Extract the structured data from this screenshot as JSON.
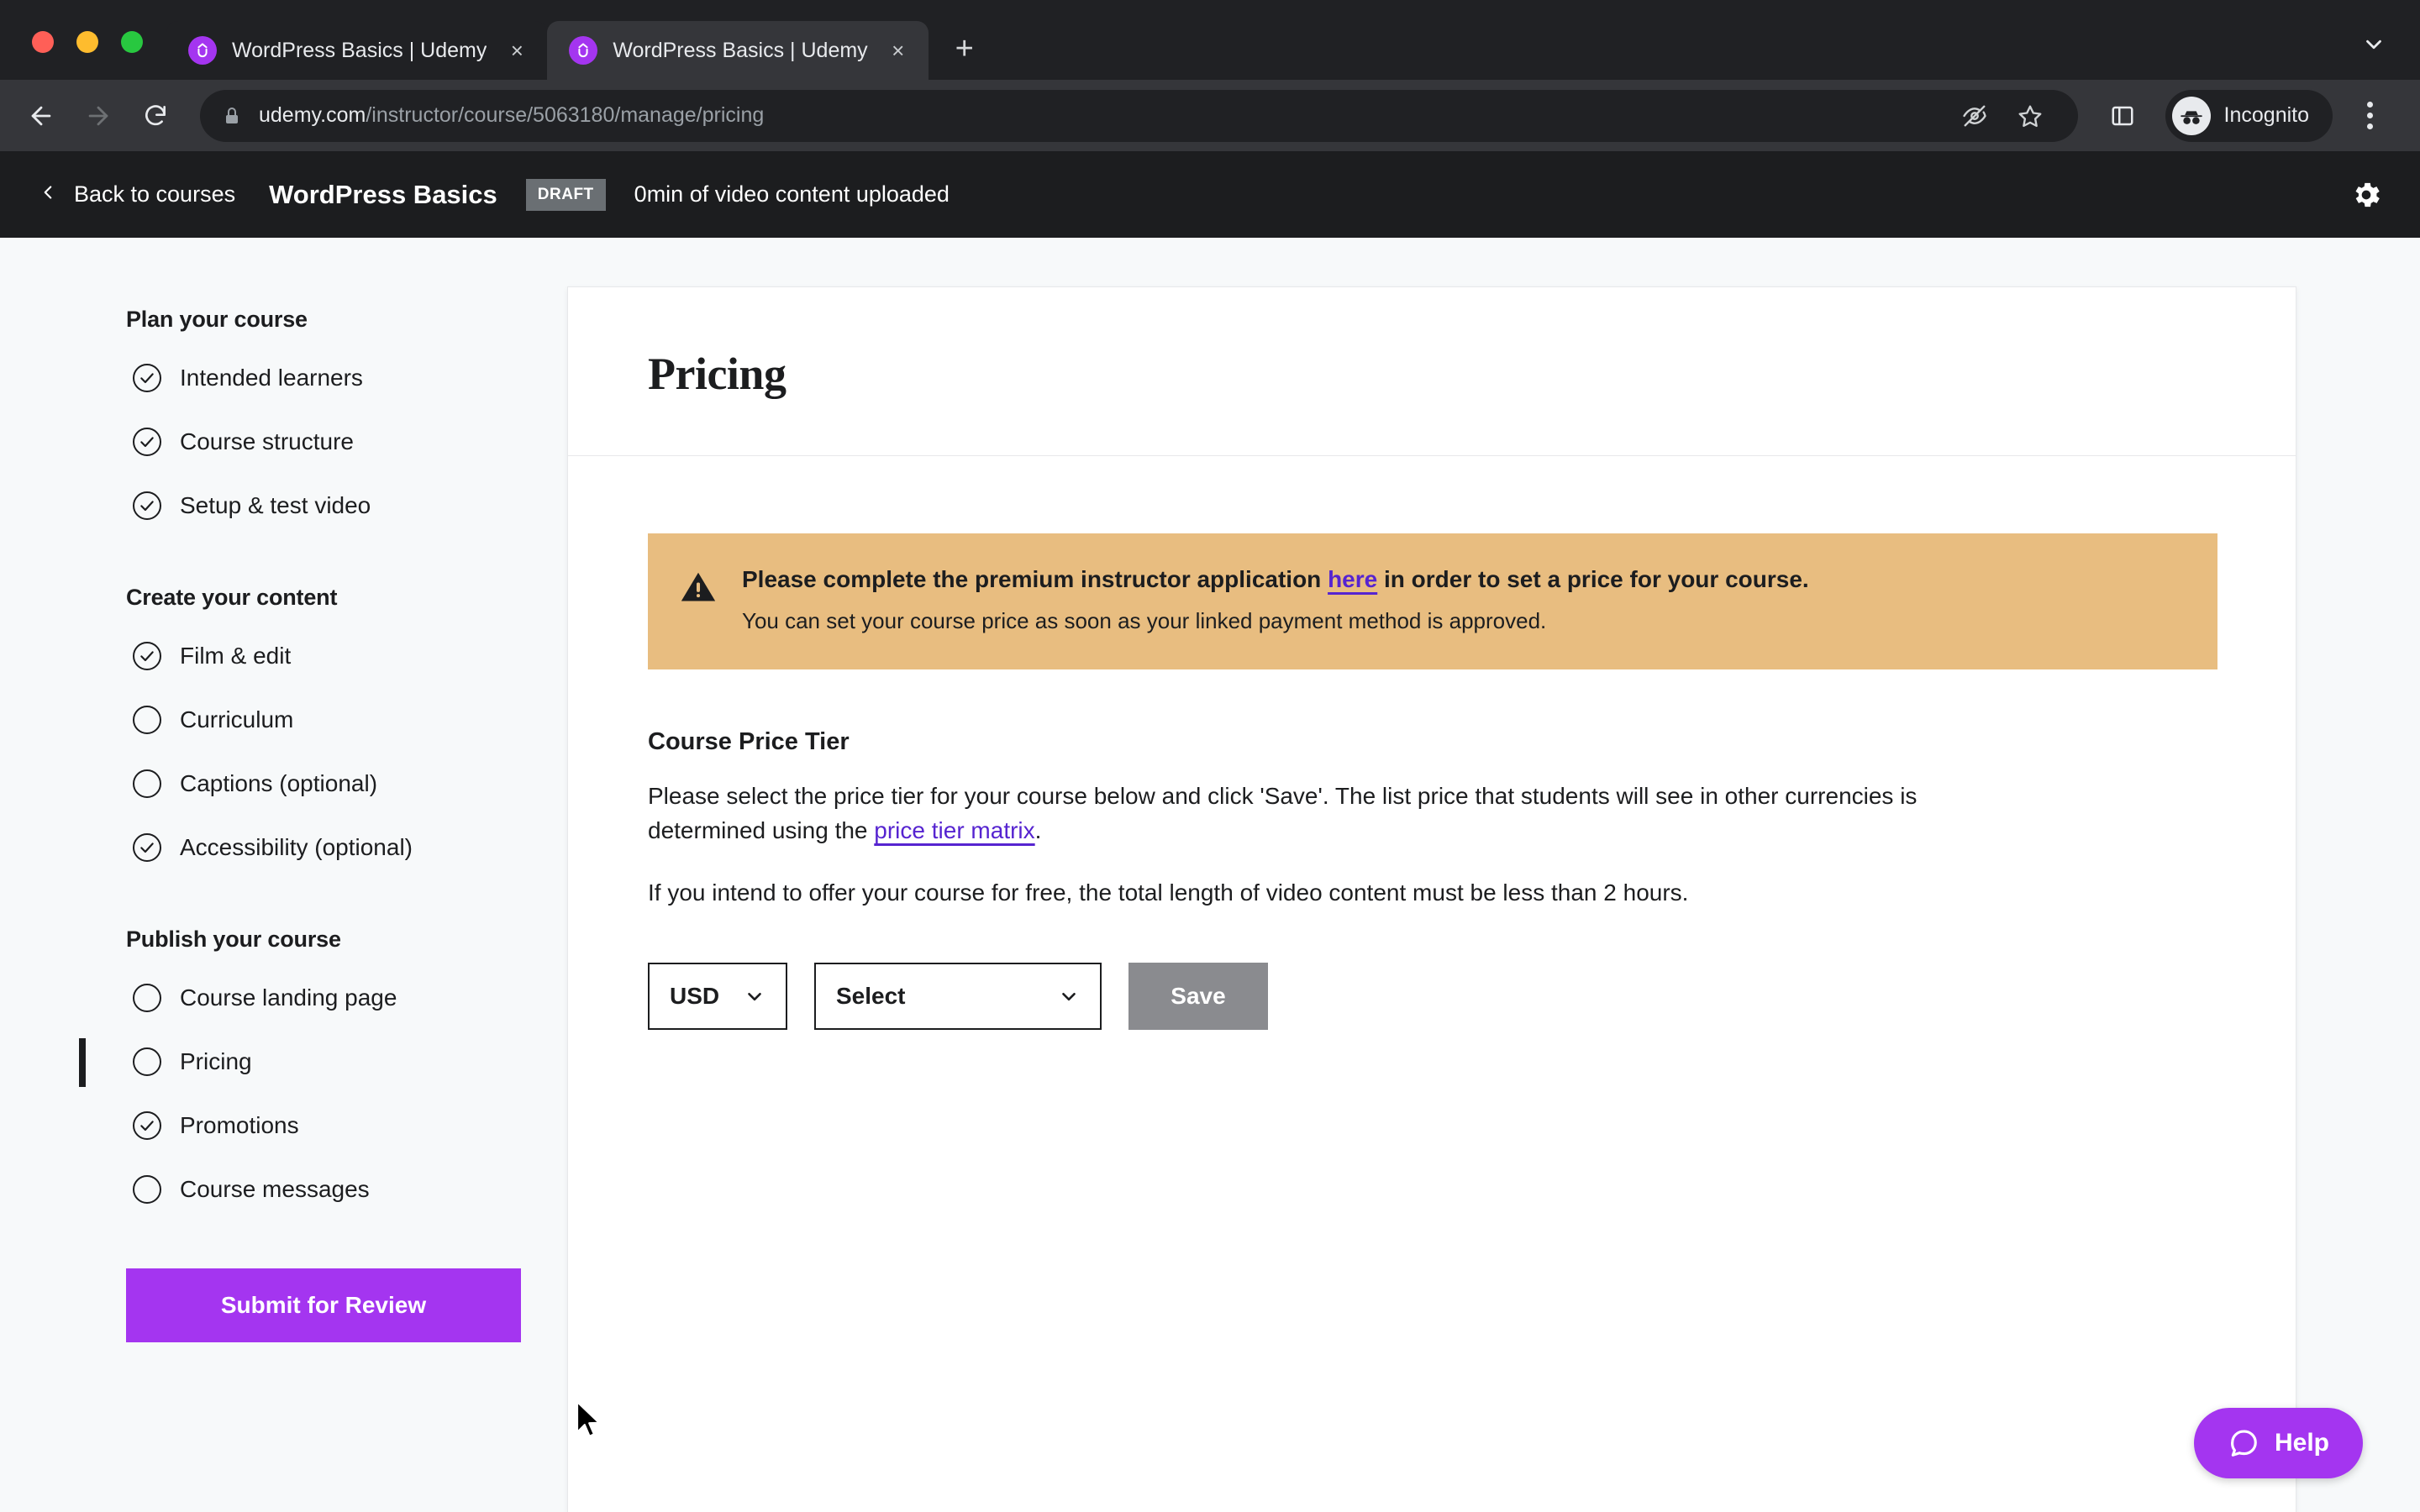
{
  "browser": {
    "tabs": [
      {
        "title": "WordPress Basics | Udemy",
        "active": false,
        "favicon": "udemy-logo-icon",
        "close": "×"
      },
      {
        "title": "WordPress Basics | Udemy",
        "active": true,
        "favicon": "udemy-logo-icon",
        "close": "×"
      }
    ],
    "new_tab_label": "+",
    "tab_list_chevron": "chevron-down-icon",
    "url_domain": "udemy.com",
    "url_path": "/instructor/course/5063180/manage/pricing",
    "profile_label": "Incognito",
    "back_icon": "back-arrow-icon",
    "forward_icon": "forward-arrow-icon",
    "reload_icon": "reload-icon",
    "lock_icon": "lock-icon",
    "tracking_icon": "eye-off-icon",
    "bookmark_icon": "star-icon",
    "side_panel_icon": "side-panel-icon",
    "menu_icon": "kebab-menu-icon"
  },
  "header": {
    "back_label": "Back to courses",
    "course_title": "WordPress Basics",
    "status_badge": "DRAFT",
    "upload_status": "0min of video content uploaded",
    "settings_icon": "gear-icon"
  },
  "sidebar": {
    "groups": [
      {
        "heading": "Plan your course",
        "items": [
          {
            "label": "Intended learners",
            "complete": true,
            "current": false
          },
          {
            "label": "Course structure",
            "complete": true,
            "current": false
          },
          {
            "label": "Setup & test video",
            "complete": true,
            "current": false
          }
        ]
      },
      {
        "heading": "Create your content",
        "items": [
          {
            "label": "Film & edit",
            "complete": true,
            "current": false
          },
          {
            "label": "Curriculum",
            "complete": false,
            "current": false
          },
          {
            "label": "Captions (optional)",
            "complete": false,
            "current": false
          },
          {
            "label": "Accessibility (optional)",
            "complete": true,
            "current": false
          }
        ]
      },
      {
        "heading": "Publish your course",
        "items": [
          {
            "label": "Course landing page",
            "complete": false,
            "current": false
          },
          {
            "label": "Pricing",
            "complete": false,
            "current": true
          },
          {
            "label": "Promotions",
            "complete": true,
            "current": false
          },
          {
            "label": "Course messages",
            "complete": false,
            "current": false
          }
        ]
      }
    ],
    "submit_label": "Submit for Review"
  },
  "main": {
    "page_title": "Pricing",
    "alert": {
      "icon": "warning-triangle-icon",
      "line1_before": "Please complete the premium instructor application ",
      "line1_link": "here",
      "line1_after": " in order to set a price for your course.",
      "line2": "You can set your course price as soon as your linked payment method is approved."
    },
    "section_title": "Course Price Tier",
    "paragraph1_before": "Please select the price tier for your course below and click 'Save'. The list price that students will see in other currencies is determined using the ",
    "paragraph1_link": "price tier matrix",
    "paragraph1_after": ".",
    "paragraph2": "If you intend to offer your course for free, the total length of video content must be less than 2 hours.",
    "currency_value": "USD",
    "tier_value": "Select",
    "save_label": "Save"
  },
  "help": {
    "label": "Help",
    "icon": "chat-bubble-icon"
  },
  "colors": {
    "brand_purple": "#a435f0",
    "link_purple": "#5624d0",
    "alert_bg": "#e8bd80",
    "dark_header": "#1c1d1f",
    "save_disabled": "#8a8b8f",
    "page_bg": "#f7f9fa"
  }
}
